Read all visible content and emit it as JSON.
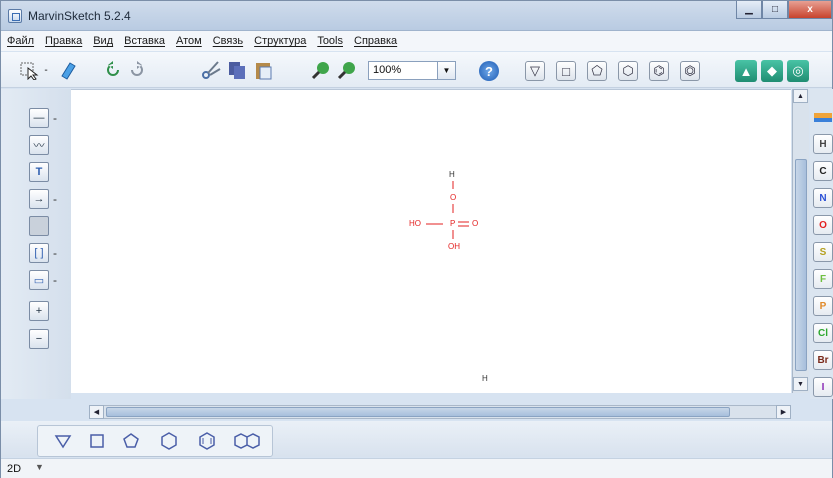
{
  "window": {
    "title": "MarvinSketch 5.2.4",
    "minimize_glyph": "▁",
    "maximize_glyph": "□",
    "close_glyph": "x"
  },
  "menubar": {
    "items": [
      "Файл",
      "Правка",
      "Вид",
      "Вставка",
      "Атом",
      "Связь",
      "Структура",
      "Tools",
      "Справка"
    ]
  },
  "toolbar": {
    "zoom_value": "100%",
    "zoom_dropdown_glyph": "▼",
    "help_label": "?",
    "icons": [
      "select-icon",
      "erase-icon",
      "undo-icon",
      "redo-icon",
      "cut-icon",
      "copy-icon",
      "paste-icon",
      "zoom-in-icon",
      "zoom-out-icon",
      "help-icon",
      "cyclopropane-icon",
      "cyclobutane-icon",
      "cyclopentane-icon",
      "cyclohexane-icon",
      "benzene-icon",
      "naphthalene-icon",
      "template-icon-1",
      "template-icon-2",
      "template-icon-3"
    ]
  },
  "left_tools": [
    {
      "name": "single-bond-tool",
      "glyph": "—",
      "more": "-"
    },
    {
      "name": "wavy-bond-tool",
      "glyph": "〰",
      "more": ""
    },
    {
      "name": "text-tool",
      "glyph": "T",
      "more": ""
    },
    {
      "name": "arrow-tool",
      "glyph": "→",
      "more": "-"
    },
    {
      "name": "blank-tool",
      "glyph": "",
      "more": ""
    },
    {
      "name": "bracket-tool",
      "glyph": "[ ]",
      "more": "-"
    },
    {
      "name": "rectangle-tool",
      "glyph": "▭",
      "more": "-"
    },
    {
      "name": "plus-charge-tool",
      "glyph": "+",
      "more": ""
    },
    {
      "name": "minus-charge-tool",
      "glyph": "−",
      "more": ""
    }
  ],
  "molecule": {
    "atoms": {
      "h_top": "H",
      "o_top": "O",
      "ho_left": "HO",
      "p_center": "P",
      "o_double": "O",
      "oh_bottom": "OH"
    },
    "stray_atom": "H",
    "atom_color": "#e32222"
  },
  "elements": [
    {
      "symbol": "H",
      "color": "#444444"
    },
    {
      "symbol": "C",
      "color": "#222222"
    },
    {
      "symbol": "N",
      "color": "#2d52d6"
    },
    {
      "symbol": "O",
      "color": "#e32222"
    },
    {
      "symbol": "S",
      "color": "#b5a020"
    },
    {
      "symbol": "F",
      "color": "#6fbf40"
    },
    {
      "symbol": "P",
      "color": "#e08a2a"
    },
    {
      "symbol": "Cl",
      "color": "#2fa82f"
    },
    {
      "symbol": "Br",
      "color": "#7a2a1a"
    },
    {
      "symbol": "I",
      "color": "#8a2bb4"
    }
  ],
  "shapes": [
    "cyclopropane-shape",
    "cyclobutane-shape",
    "cyclopentane-shape",
    "cyclohexane-shape",
    "benzene-shape",
    "naphthalene-shape"
  ],
  "status": {
    "mode": "2D",
    "dropdown_glyph": "▼"
  }
}
